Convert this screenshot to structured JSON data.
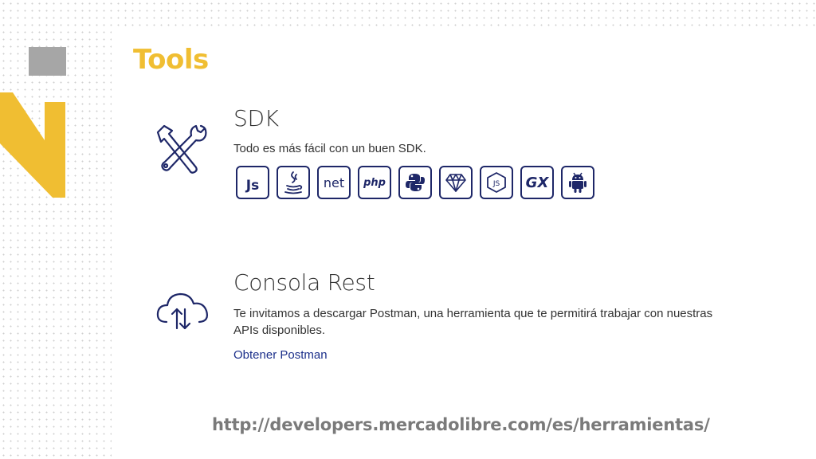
{
  "slide": {
    "title": "Tools",
    "footer_url": "http://developers.mercadolibre.com/es/herramientas/"
  },
  "sdk": {
    "title": "SDK",
    "description": "Todo es más fácil con un buen SDK.",
    "badges": [
      {
        "icon": "javascript-icon",
        "label": "Js"
      },
      {
        "icon": "java-icon",
        "label": ""
      },
      {
        "icon": "dotnet-icon",
        "label": "net"
      },
      {
        "icon": "php-icon",
        "label": "php"
      },
      {
        "icon": "python-icon",
        "label": ""
      },
      {
        "icon": "ruby-icon",
        "label": ""
      },
      {
        "icon": "nodejs-icon",
        "label": ""
      },
      {
        "icon": "genexus-icon",
        "label": "GX"
      },
      {
        "icon": "android-icon",
        "label": ""
      }
    ]
  },
  "rest_console": {
    "title": "Consola Rest",
    "description": "Te invitamos a descargar Postman, una herramienta que te permitirá trabajar con nuestras APIs disponibles.",
    "link_label": "Obtener Postman"
  },
  "colors": {
    "accent_yellow": "#f0be32",
    "badge_navy": "#1e2768",
    "link_blue": "#1b2f8a",
    "decor_gray": "#a6a6a6"
  }
}
